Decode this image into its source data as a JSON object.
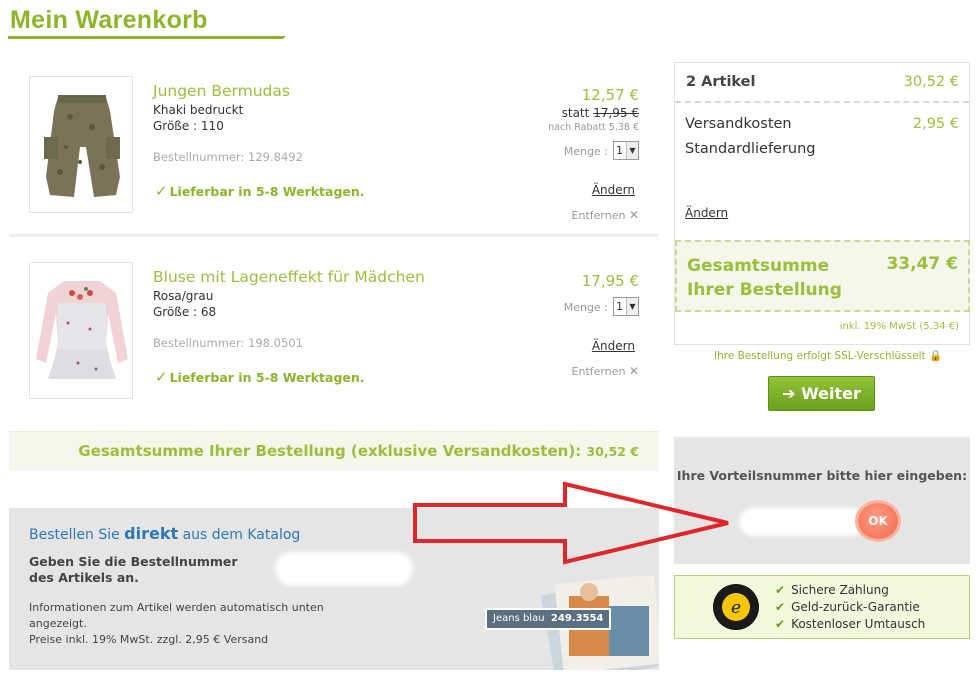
{
  "page_title": "Mein Warenkorb",
  "items": [
    {
      "name": "Jungen Bermudas",
      "desc": "Khaki bedruckt",
      "size": "Größe : 110",
      "order_no": "Bestellnummer: 129.8492",
      "availability": "Lieferbar in 5-8 Werktagen.",
      "price": "12,57 €",
      "statt_label": "statt",
      "old_price": "17,95 €",
      "discount": "nach Rabatt 5,38 €",
      "qty_label": "Menge :",
      "qty": "1",
      "edit": "Ändern",
      "remove": "Entfernen"
    },
    {
      "name": "Bluse mit Lageneffekt für Mädchen",
      "desc": "Rosa/grau",
      "size": "Größe : 68",
      "order_no": "Bestellnummer: 198.0501",
      "availability": "Lieferbar in 5-8 Werktagen.",
      "price": "17,95 €",
      "qty_label": "Menge :",
      "qty": "1",
      "edit": "Ändern",
      "remove": "Entfernen"
    }
  ],
  "subtotal": {
    "label": "Gesamtsumme Ihrer Bestellung (exklusive Versandkosten):",
    "value": "30,52 €"
  },
  "catalog": {
    "title_pre": "Bestellen Sie ",
    "title_bold": "direkt",
    "title_post": " aus dem Katalog",
    "desc": "Geben Sie die Bestellnummer des Artikels an.",
    "info": "Informationen zum Artikel werden automatisch unten angezeigt.",
    "info2": "Preise inkl. 19% MwSt. zzgl. 2,95 € Versand",
    "badge_name": "Jeans blau",
    "badge_no": "249.3554"
  },
  "summary": {
    "articles": "2 Artikel",
    "articles_value": "30,52 €",
    "shipping": "Versandkosten",
    "shipping_value": "2,95 €",
    "shipping_type": "Standardlieferung",
    "edit": "Ändern",
    "total_label_1": "Gesamtsumme",
    "total_label_2": "Ihrer Bestellung",
    "total_value": "33,47 €",
    "vat": "inkl. 19% MwSt (5,34 €)",
    "ssl": "Ihre Bestellung erfolgt  SSL-Verschlüsselt",
    "continue": "Weiter"
  },
  "voucher": {
    "label": "Ihre Vorteilsnummer bitte hier eingeben:",
    "ok": "OK"
  },
  "trust": {
    "items": [
      "Sichere Zahlung",
      "Geld-zurück-Garantie",
      "Kostenloser Umtausch"
    ],
    "logo_letter": "e",
    "logo_ring": "TRUSTED SHOPS GUARANTEE"
  },
  "colors": {
    "brand_green": "#8db52a",
    "link_blue": "#2e78b4",
    "ok_red": "#f26a4e",
    "annotation_arrow": "#e0252b"
  }
}
